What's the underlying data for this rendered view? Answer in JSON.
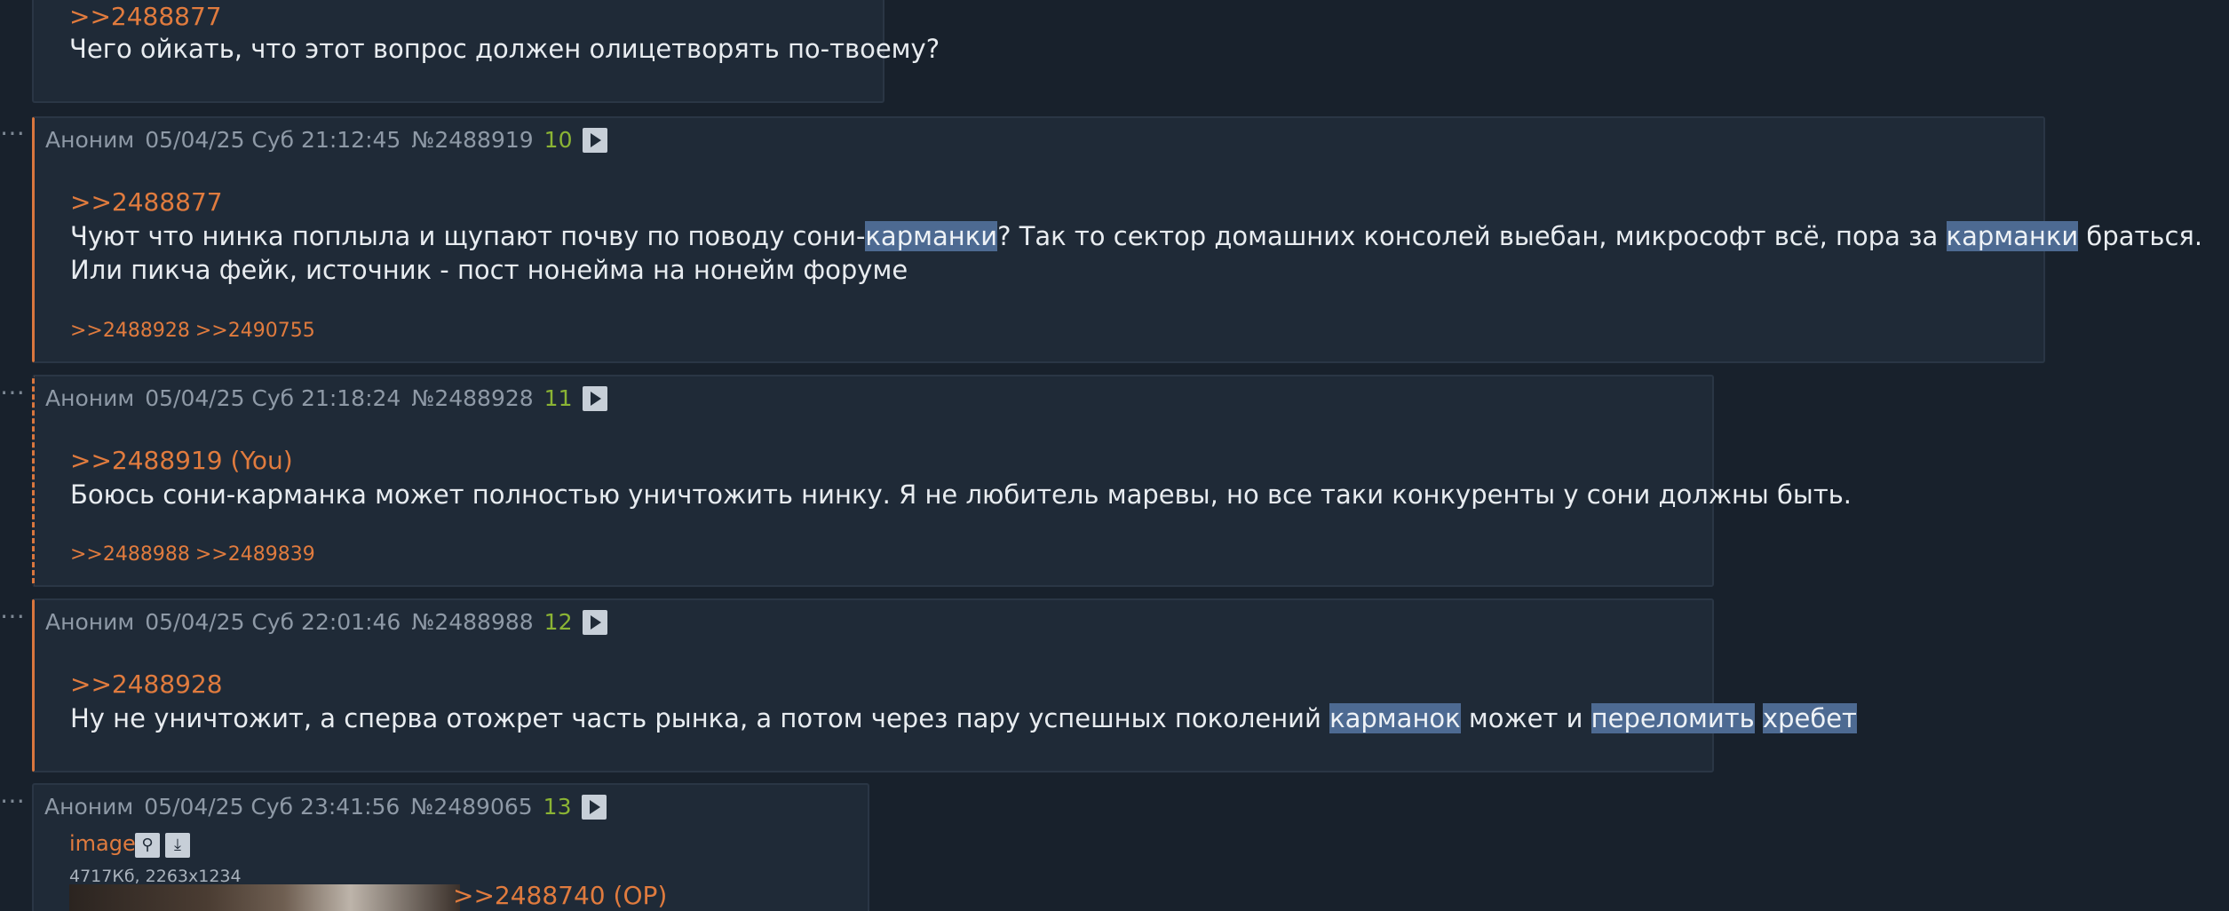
{
  "posts": [
    {
      "quote": ">>2488877",
      "lines": [
        "Чего ойкать, что этот вопрос должен олицетворять по-твоему?"
      ]
    },
    {
      "author": "Аноним",
      "datetime": "05/04/25 Суб 21:12:45",
      "id": "№2488919",
      "index": "10",
      "quote": ">>2488877",
      "line1": {
        "a": "Чуют что нинка поплыла и щупают почву по поводу сони-",
        "hl1": "карманки",
        "b": "? Так то сектор домашних консолей выебан, микрософт всё, пора за ",
        "hl2": "карманки",
        "c": " браться."
      },
      "line2": "Или пикча фейк, источник - пост нонейма на нонейм форуме",
      "replies": [
        ">>2488928",
        ">>2490755"
      ]
    },
    {
      "author": "Аноним",
      "datetime": "05/04/25 Суб 21:18:24",
      "id": "№2488928",
      "index": "11",
      "quote": ">>2488919 (You)",
      "line1": "Боюсь сони-карманка может полностью уничтожить нинку. Я не любитель маревы, но все таки конкуренты у сони должны быть.",
      "replies": [
        ">>2488988",
        ">>2489839"
      ]
    },
    {
      "author": "Аноним",
      "datetime": "05/04/25 Суб 22:01:46",
      "id": "№2488988",
      "index": "12",
      "quote": ">>2488928",
      "line1": {
        "a": "Ну не уничтожит, а сперва отожрет часть рынка, а потом через пару успешных поколений ",
        "hl1": "карманок",
        "b": " может и ",
        "hl2": "переломить",
        "c": " ",
        "hl3": "хребет"
      }
    },
    {
      "author": "Аноним",
      "datetime": "05/04/25 Суб 23:41:56",
      "id": "№2489065",
      "index": "13",
      "file": {
        "name": "image",
        "meta": "4717Кб, 2263x1234"
      },
      "quote": ">>2488740 (OP)"
    }
  ],
  "icons": {
    "play": "play-icon",
    "search": "magnifier-icon",
    "download": "download-icon",
    "reply_marker": "ellipsis-icon"
  },
  "colors": {
    "background": "#18212c",
    "post_bg": "#1f2a37",
    "link": "#e07b3e",
    "index": "#8bb434",
    "highlight": "#4d6a92"
  }
}
